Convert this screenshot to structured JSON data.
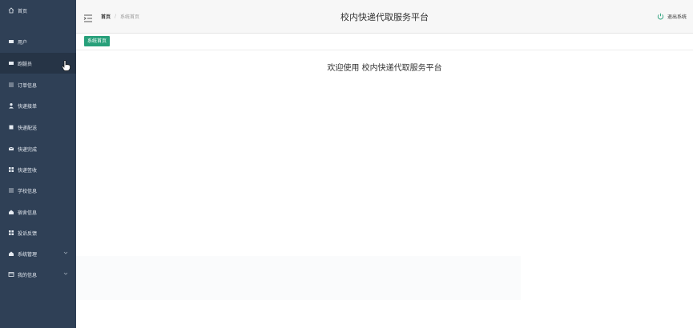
{
  "sidebar": {
    "items": [
      {
        "label": "首页",
        "icon": "home-icon"
      },
      {
        "label": "用户",
        "icon": "user-list-icon"
      },
      {
        "label": "跑腿员",
        "icon": "runner-icon"
      },
      {
        "label": "订单信息",
        "icon": "order-icon"
      },
      {
        "label": "快递接单",
        "icon": "person-icon"
      },
      {
        "label": "快递配送",
        "icon": "delivery-icon"
      },
      {
        "label": "快递完成",
        "icon": "complete-icon"
      },
      {
        "label": "快递签收",
        "icon": "grid-icon"
      },
      {
        "label": "学校信息",
        "icon": "list-icon"
      },
      {
        "label": "宿舍信息",
        "icon": "dorm-icon"
      },
      {
        "label": "投诉反馈",
        "icon": "grid-icon"
      },
      {
        "label": "系统管理",
        "icon": "system-icon",
        "expandable": true
      },
      {
        "label": "我的信息",
        "icon": "info-icon",
        "expandable": true
      }
    ],
    "active_index": 2
  },
  "header": {
    "breadcrumb": {
      "home": "首页",
      "separator": "/",
      "current": "系统首页"
    },
    "title": "校内快递代取服务平台",
    "logout_label": "退出系统"
  },
  "tabs": [
    {
      "label": "系统首页"
    }
  ],
  "main": {
    "welcome": "欢迎使用 校内快递代取服务平台"
  },
  "colors": {
    "sidebar_bg": "#2f4056",
    "sidebar_active_bg": "#263446",
    "tab_active_bg": "#27a07a",
    "logout_icon": "#27a07a"
  }
}
